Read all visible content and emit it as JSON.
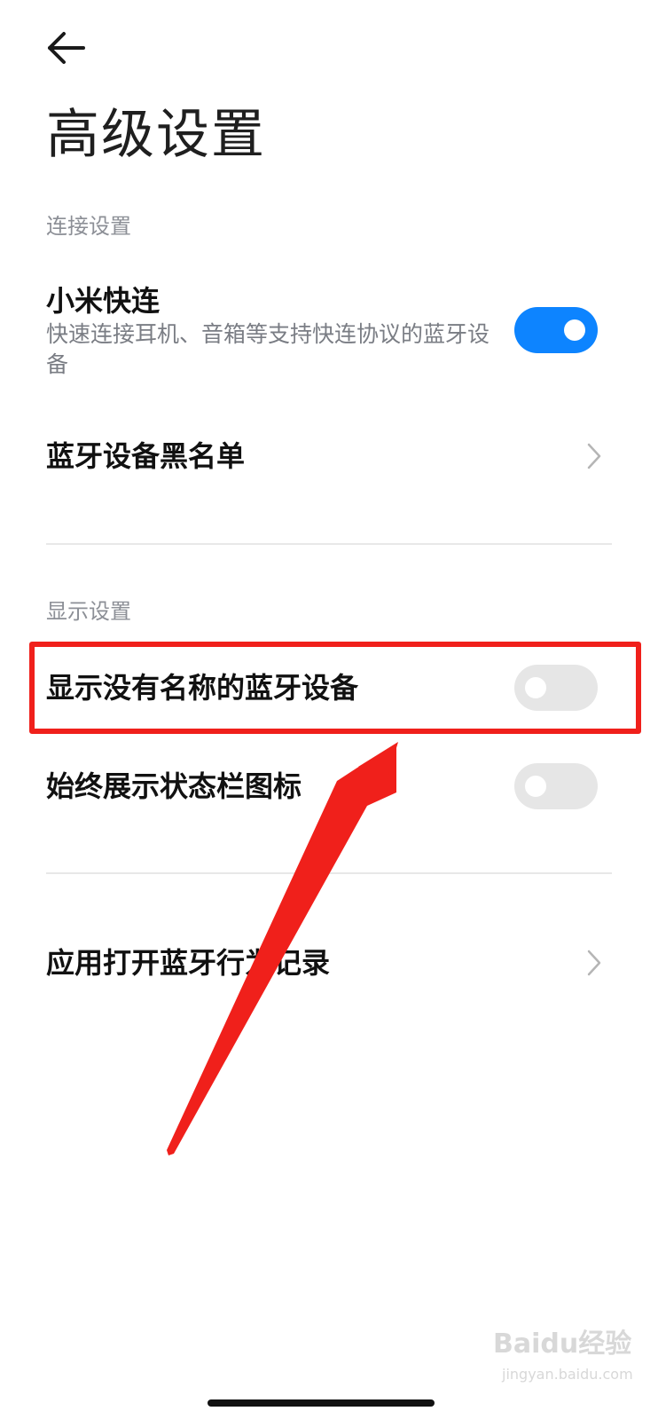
{
  "header": {
    "title": "高级设置",
    "back_icon": "back-arrow-icon"
  },
  "sections": {
    "connection": {
      "header": "连接设置",
      "quick_connect": {
        "title": "小米快连",
        "subtitle": "快速连接耳机、音箱等支持快连协议的蓝牙设备",
        "enabled": true
      },
      "blacklist": {
        "title": "蓝牙设备黑名单"
      }
    },
    "display": {
      "header": "显示设置",
      "show_unnamed": {
        "title": "显示没有名称的蓝牙设备",
        "enabled": false
      },
      "status_bar_icon": {
        "title": "始终展示状态栏图标",
        "enabled": false
      }
    },
    "records": {
      "app_bluetooth_log": {
        "title": "应用打开蓝牙行为记录"
      }
    }
  },
  "annotation": {
    "highlight_color": "#f0201b"
  },
  "watermark": {
    "brand": "Baidu经验",
    "url": "jingyan.baidu.com"
  },
  "colors": {
    "accent": "#0d84ff",
    "toggle_off": "#e6e6e6"
  }
}
